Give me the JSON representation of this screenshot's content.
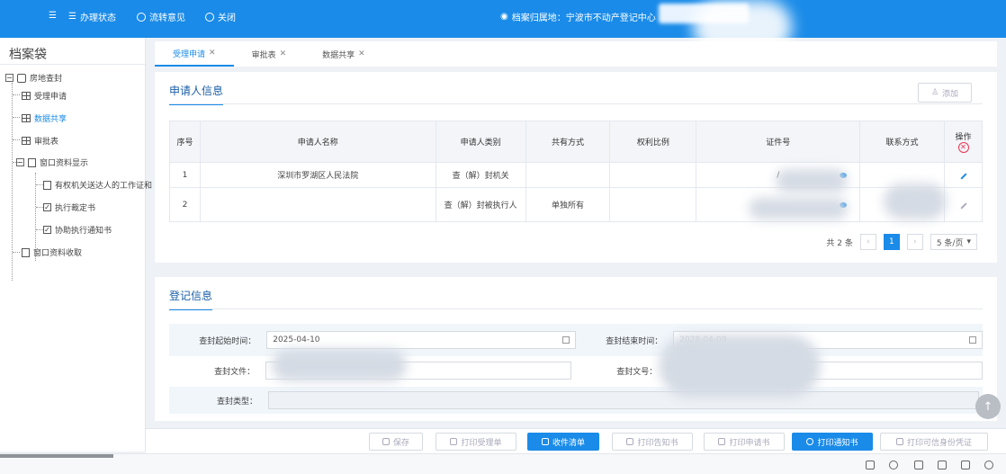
{
  "topbar": {
    "menu_glyph": "☰",
    "status_label": "办理状态",
    "feedback_label": "流转意见",
    "close_label": "关闭",
    "location_label": "档案归属地：宁波市不动产登记中心"
  },
  "sidebar": {
    "title": "档案袋",
    "root": "房地查封",
    "items": [
      {
        "label": "受理申请"
      },
      {
        "label": "数据共享"
      },
      {
        "label": "审批表"
      },
      {
        "label": "窗口资料显示"
      },
      {
        "label": "有权机关送达人的工作证和"
      },
      {
        "label": "执行裁定书"
      },
      {
        "label": "协助执行通知书"
      },
      {
        "label": "窗口资料收取"
      }
    ]
  },
  "tabs": [
    {
      "label": "受理申请"
    },
    {
      "label": "审批表"
    },
    {
      "label": "数据共享"
    }
  ],
  "applicant": {
    "title": "申请人信息",
    "add_label": "添加",
    "columns": [
      "序号",
      "申请人名称",
      "申请人类别",
      "共有方式",
      "权利比例",
      "证件号",
      "联系方式",
      "操作"
    ],
    "rows": [
      {
        "no": "1",
        "name": "深圳市罗湖区人民法院",
        "type": "查（解）封机关",
        "share": "",
        "ratio": "",
        "id": "/",
        "contact": ""
      },
      {
        "no": "2",
        "name": "",
        "type": "查（解）封被执行人",
        "share": "单独所有",
        "ratio": "",
        "id": "",
        "contact": ""
      }
    ],
    "pager": {
      "total": "共 2 条",
      "current": "1",
      "page_size": "5 条/页"
    }
  },
  "registration": {
    "title": "登记信息",
    "start_label": "查封起始时间：",
    "start_value": "2025-04-10",
    "end_label": "查封结束时间：",
    "end_value": "2028-04-09",
    "file_label": "查封文件：",
    "file_no_label": "查封文号：",
    "type_label": "查封类型："
  },
  "actions": {
    "save": "保存",
    "print_accept": "打印受理单",
    "receipt_list": "收件清单",
    "print_notice": "打印告知书",
    "print_application": "打印申请书",
    "print_notify": "打印通知书",
    "print_credential": "打印可信身份凭证"
  },
  "colors": {
    "primary": "#1a8be8",
    "danger": "#e33355"
  }
}
